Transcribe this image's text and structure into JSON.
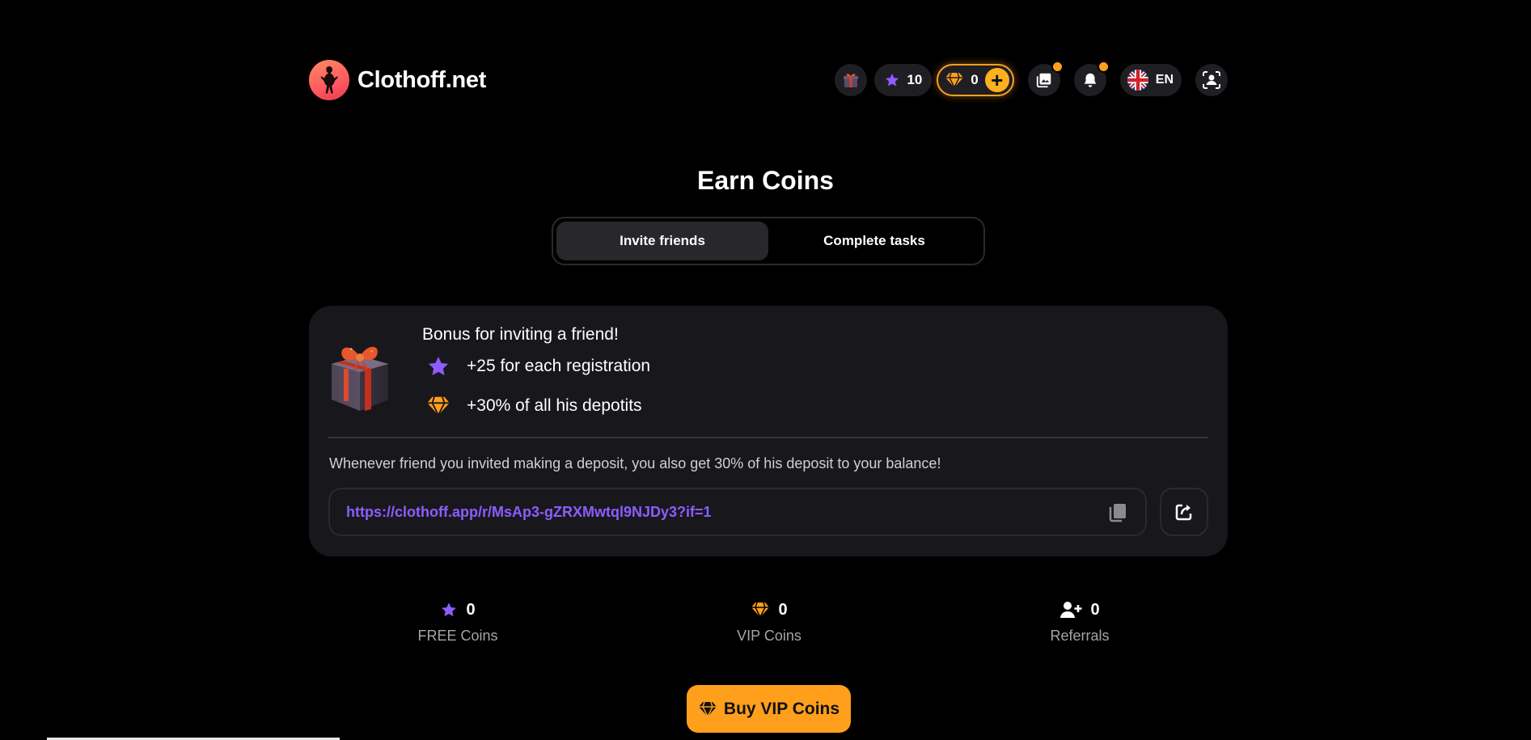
{
  "brand": {
    "name": "Clothoff.net"
  },
  "header": {
    "free_coins": "10",
    "vip_coins": "0",
    "language": "EN"
  },
  "page": {
    "title": "Earn Coins",
    "tabs": [
      {
        "label": "Invite friends",
        "active": true
      },
      {
        "label": "Complete tasks",
        "active": false
      }
    ]
  },
  "invite_card": {
    "title": "Bonus for inviting a friend!",
    "registration_bonus": "+25 for each registration",
    "deposit_bonus": "+30% of all his depotits",
    "description": "Whenever friend you invited making a deposit, you also get 30% of his deposit to your balance!",
    "referral_link": "https://clothoff.app/r/MsAp3-gZRXMwtql9NJDy3?if=1"
  },
  "stats": [
    {
      "icon": "star-icon",
      "value": "0",
      "label": "FREE Coins"
    },
    {
      "icon": "diamond-icon",
      "value": "0",
      "label": "VIP Coins"
    },
    {
      "icon": "user-plus-icon",
      "value": "0",
      "label": "Referrals"
    }
  ],
  "buy_button": {
    "label": "Buy VIP Coins"
  },
  "colors": {
    "accent_orange": "#ff9f1c",
    "accent_purple": "#8e5cff",
    "card_bg": "#18181c",
    "page_bg": "#000000"
  }
}
